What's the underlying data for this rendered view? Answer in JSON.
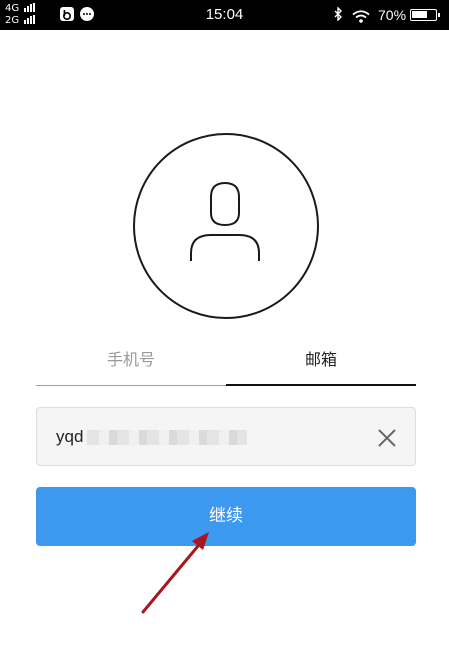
{
  "status_bar": {
    "network_1": "4G",
    "network_2": "2G",
    "time": "15:04",
    "battery": "70%",
    "battery_level": 0.7,
    "icons": [
      "baidu-app-icon",
      "wechat-icon",
      "bluetooth-icon",
      "wifi-icon",
      "battery-icon"
    ]
  },
  "avatar": {
    "icon": "user-icon"
  },
  "tabs": [
    {
      "label": "手机号",
      "active": false
    },
    {
      "label": "邮箱",
      "active": true
    }
  ],
  "email_input": {
    "value": "yqd",
    "clear_icon": "close-icon"
  },
  "continue_button": {
    "label": "继续"
  },
  "colors": {
    "primary": "#3d98f0",
    "annotation_arrow": "#a8161f"
  }
}
